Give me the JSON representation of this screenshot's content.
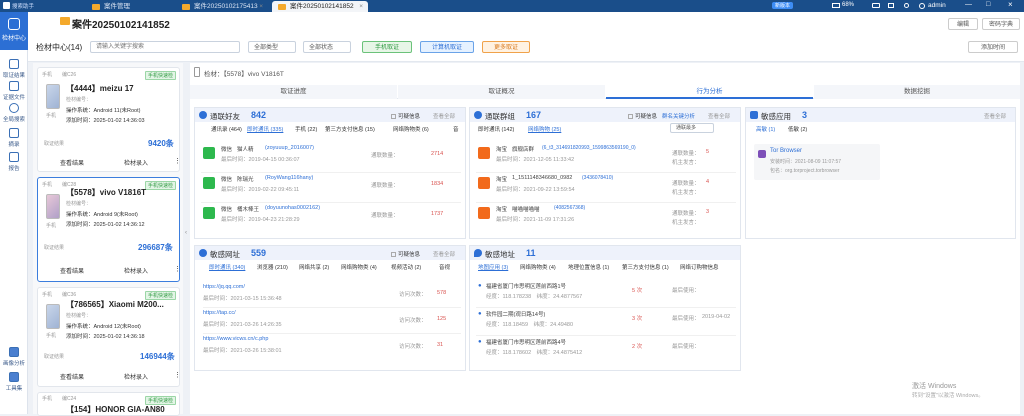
{
  "titlebar": {
    "app_name": "搜索助手",
    "tabs": [
      "案件管理",
      "案件20250102175413",
      "案件20250102141852"
    ],
    "admin": "admin",
    "battery": "68%",
    "time_label": "新版本"
  },
  "sidebar": {
    "items": [
      "检材中心",
      "取证结果",
      "证据文件",
      "全局搜索",
      "摘录",
      "报告",
      "画像分析",
      "工具集"
    ]
  },
  "header": {
    "case_title": "案件20250102141852",
    "header_actions": [
      "编辑",
      "密码字典"
    ],
    "center_label": "检材中心(14)",
    "search_placeholder": "请输入关键字搜索",
    "type_filter": "全部类型",
    "status_filter": "全部状态",
    "btn_phone": "手机取证",
    "btn_computer": "计算机取证",
    "btn_more": "更多取证",
    "btn_add": "添加时间"
  },
  "devices": [
    {
      "id": "【4444】meizu 17",
      "tag": "手机",
      "num": "编C26",
      "badge": "手机快速检",
      "lines": [
        "检材编号：",
        "操作系统：Android 11(未Root)",
        "添加时间：2025-01-02 14:36:03"
      ],
      "size": "9420条",
      "actions": [
        "查看结果",
        "检材录入"
      ]
    },
    {
      "id": "【5578】vivo V1816T",
      "tag": "手机",
      "num": "编C28",
      "badge": "手机快速检",
      "lines": [
        "检材编号：",
        "操作系统：Android 9(未Root)",
        "添加时间：2025-01-02 14:36:12"
      ],
      "size": "296687条",
      "actions": [
        "查看结果",
        "检材录入"
      ]
    },
    {
      "id": "【786565】Xiaomi M200...",
      "tag": "手机",
      "num": "编C36",
      "badge": "手机快速检",
      "lines": [
        "检材编号：",
        "操作系统：Android 12(未Root)",
        "添加时间：2025-01-02 14:36:18"
      ],
      "size": "146944条",
      "actions": [
        "查看结果",
        "检材录入"
      ]
    },
    {
      "id": "【154】HONOR GIA-AN80",
      "tag": "手机",
      "num": "编C24",
      "badge": "手机快速检",
      "lines": [],
      "size": "",
      "actions": []
    }
  ],
  "detail": {
    "breadcrumb": "检材：【5578】vivo V1816T",
    "tabs": [
      "取证进度",
      "取证概况",
      "行为分析",
      "数据挖掘"
    ]
  },
  "contacts": {
    "title": "通联好友",
    "count": "842",
    "tabs": [
      "通讯录 (464)",
      "即时通讯 (335)",
      "手机 (22)",
      "第三方支付信息 (15)",
      "网络购物类 (6)",
      "音"
    ],
    "filter": "可疑信息",
    "more": "查看全部",
    "entries": [
      {
        "app": "微信",
        "name": "猫人精",
        "id": "(zoyuuup_2016007)",
        "time": "最后时间：2019-04-15 00:36:07",
        "label": "通联数量：",
        "count": "2714"
      },
      {
        "app": "微信",
        "name": "陈瑞光",
        "id": "(RoyWang116hany)",
        "time": "最后时间：2019-02-22 09:45:11",
        "label": "通联数量：",
        "count": "1834"
      },
      {
        "app": "微信",
        "name": "桶木棒王",
        "id": "(doyuunohas0002162)",
        "time": "最后时间：2019-04-23 21:28:29",
        "label": "通联数量：",
        "count": "1737"
      }
    ]
  },
  "groups": {
    "title": "通联群组",
    "count": "167",
    "tabs": [
      "即时通讯 (142)",
      "网络购物 (25)"
    ],
    "filter": "可疑信息",
    "extra": "群名关键分析",
    "more": "查看全部",
    "sort": "通联最多",
    "entries": [
      {
        "app": "淘宝",
        "name": "旗舰店群",
        "id": "(6_t3_314691820993_1599863569190_0)",
        "time": "最后时间：2021-12-05 11:33:42",
        "count": "5"
      },
      {
        "app": "淘宝",
        "name": "1_1511148346680_0982",
        "id": "(3436078410)",
        "time": "最后时间：2021-09-22 13:59:54",
        "count": "4"
      },
      {
        "app": "淘宝",
        "name": "喵喵喵喵喵",
        "id": "(4082567368)",
        "time": "最后时间：2021-11-09 17:31:26",
        "count": "3"
      }
    ],
    "sub1": "通联数量：",
    "sub2": "机主发言："
  },
  "apps": {
    "title": "敏感应用",
    "count": "3",
    "tabs": [
      "高敏 (1)",
      "低敏 (2)"
    ],
    "more": "查看全部",
    "entry": {
      "name": "Tor Browser",
      "line1": "安装时间：2021-08-09 11:07:57",
      "line2": "包名：org.torproject.torbrowser"
    }
  },
  "urls": {
    "title": "敏感网址",
    "count": "559",
    "tabs": [
      "即时通讯 (340)",
      "浏览器 (210)",
      "网络共享 (2)",
      "网络购物类 (4)",
      "视频活动 (2)",
      "音视"
    ],
    "filter": "可疑信息",
    "more": "查看全部",
    "entries": [
      {
        "url": "https://jq.qq.com/",
        "time": "最后时间：2021-03-15 15:36:48",
        "label": "访问次数：",
        "count": "578"
      },
      {
        "url": "https://tap.cc/",
        "time": "最后时间：2021-03-26 14:26:35",
        "label": "访问次数：",
        "count": "125"
      },
      {
        "url": "https://www.vicws.cn/c.php",
        "time": "最后时间：2021-03-26 15:38:01",
        "label": "访问次数：",
        "count": "31"
      }
    ]
  },
  "address": {
    "title": "敏感地址",
    "count": "11",
    "tabs": [
      "地图应用 (3)",
      "网络购物类 (4)",
      "地理位置信息 (1)",
      "第三方支付信息 (1)",
      "网络订购物信息"
    ],
    "entries": [
      {
        "addr": "福建省厦门市思明区莲前西路1号",
        "coords": "经度：118.178238　纬度：24.4877567",
        "count": "5 次",
        "label": "最后使用："
      },
      {
        "addr": "软件园二期(观日路14号)",
        "coords": "经度：118.18459　纬度：24.49480",
        "count": "3 次",
        "label": "最后使用：",
        "last": "2019-04-02"
      },
      {
        "addr": "福建省厦门市思明区莲前西路4号",
        "coords": "经度：118.178602　纬度：24.4875412",
        "count": "2 次",
        "label": "最后使用："
      }
    ]
  },
  "watermark": {
    "line1": "激活 Windows",
    "line2": "转到\"设置\"以激活 Windows。"
  },
  "colors": {
    "brand": "#2c6fd4",
    "danger": "#d9534f",
    "wechat": "#2db84d",
    "taobao": "#f26a1b",
    "green": "#2f9a42",
    "orange": "#f0a24a"
  }
}
